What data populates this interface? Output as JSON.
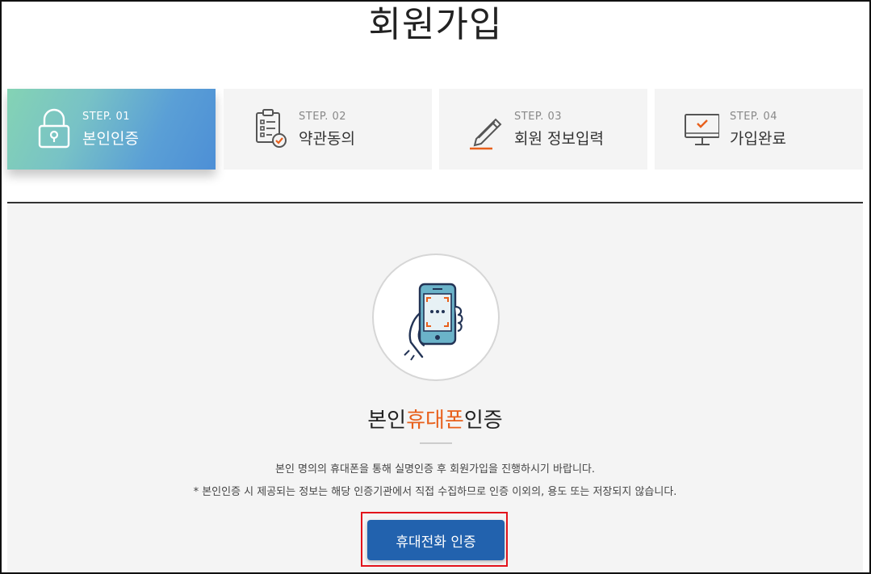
{
  "page": {
    "title": "회원가입"
  },
  "steps": [
    {
      "num": "STEP. 01",
      "name": "본인인증",
      "icon": "lock-icon",
      "active": true
    },
    {
      "num": "STEP. 02",
      "name": "약관동의",
      "icon": "checklist-icon",
      "active": false
    },
    {
      "num": "STEP. 03",
      "name": "회원 정보입력",
      "icon": "pencil-icon",
      "active": false
    },
    {
      "num": "STEP. 04",
      "name": "가입완료",
      "icon": "monitor-check-icon",
      "active": false
    }
  ],
  "cert": {
    "title_pre": "본인",
    "title_highlight": "휴대폰",
    "title_post": "인증",
    "desc1": "본인 명의의 휴대폰을 통해 실명인증 후 회원가입을 진행하시기 바랍니다.",
    "desc2": "* 본인인증 시 제공되는 정보는 해당 인증기관에서 직접 수집하므로 인증 이외의, 용도 또는 저장되지 않습니다.",
    "button": "휴대전화 인증",
    "icon": "phone-hand-icon"
  },
  "colors": {
    "accent": "#e8601c",
    "button": "#2262ae",
    "highlight_border": "#e3131b",
    "active_gradient_start": "#84d3b4",
    "active_gradient_end": "#4d8fd6"
  }
}
